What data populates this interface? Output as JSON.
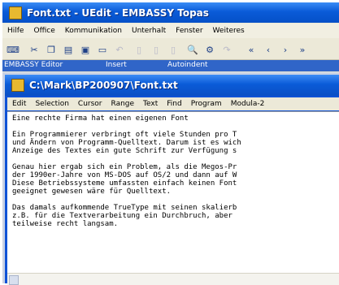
{
  "outer_window": {
    "title": "Font.txt - UEdit - EMBASSY Topas",
    "menu": [
      "Hilfe",
      "Office",
      "Kommunikation",
      "Unterhalt",
      "Fenster",
      "Weiteres"
    ]
  },
  "toolbar": {
    "icons": [
      "keyboard-icon",
      "cut-icon",
      "copy-icon",
      "paste-icon",
      "print-icon",
      "window-icon",
      "undo-icon",
      "pane-icon",
      "pane2-icon",
      "pane3-icon",
      "find-icon",
      "replace-icon",
      "redo-icon",
      "first-icon",
      "prev-icon",
      "next-icon",
      "last-icon"
    ]
  },
  "status_band": {
    "editor_label": "EMBASSY Editor",
    "mode_insert": "Insert",
    "mode_autoindent": "Autoindent"
  },
  "inner_window": {
    "title": "C:\\Mark\\BP200907\\Font.txt",
    "menu": [
      "Edit",
      "Selection",
      "Cursor",
      "Range",
      "Text",
      "Find",
      "Program",
      "Modula-2"
    ]
  },
  "editor": {
    "lines": [
      "Eine rechte Firma hat einen eigenen Font",
      "",
      "Ein Programmierer verbringt oft viele Stunden pro T",
      "und Ändern von Programm-Quelltext. Darum ist es wich",
      "Anzeige des Textes ein gute Schrift zur Verfügung s",
      "",
      "Genau hier ergab sich ein Problem, als die Megos-Pr",
      "der 1990er-Jahre von MS-DOS auf OS/2 und dann auf W",
      "Diese Betriebssysteme umfassten einfach keinen Font",
      "geeignet gewesen wäre für Quelltext.",
      "",
      "Das damals aufkommende TrueType mit seinen skalierb",
      "z.B. für die Textverarbeitung ein Durchbruch, aber",
      "teilweise recht langsam."
    ]
  }
}
